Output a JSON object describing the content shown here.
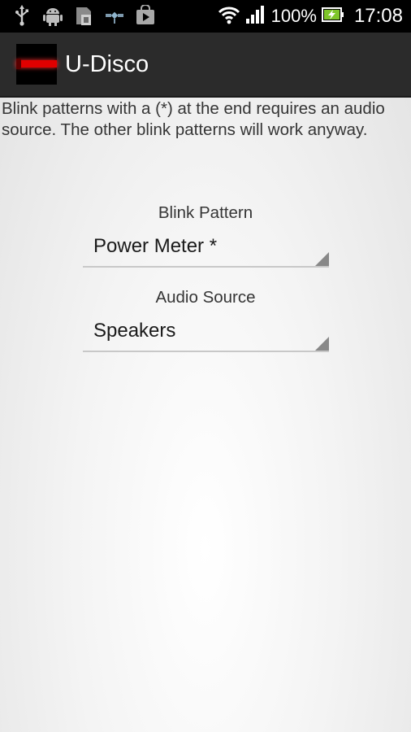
{
  "status_bar": {
    "icons_left": [
      "usb-icon",
      "android-debug-icon",
      "sim-card-icon",
      "satellite-icon",
      "play-store-icon"
    ],
    "battery_percent": "100%",
    "time": "17:08"
  },
  "action_bar": {
    "title": "U-Disco"
  },
  "main": {
    "info_text": "Blink patterns with a (*) at the end requires an audio source. The other blink patterns will work anyway.",
    "blink_pattern": {
      "label": "Blink Pattern",
      "value": "Power Meter *"
    },
    "audio_source": {
      "label": "Audio Source",
      "value": "Speakers"
    }
  },
  "colors": {
    "status_bar_bg": "#000000",
    "action_bar_bg": "#2b2b2b",
    "logo_stripe": "#e00000",
    "battery_green": "#7fc62a"
  }
}
